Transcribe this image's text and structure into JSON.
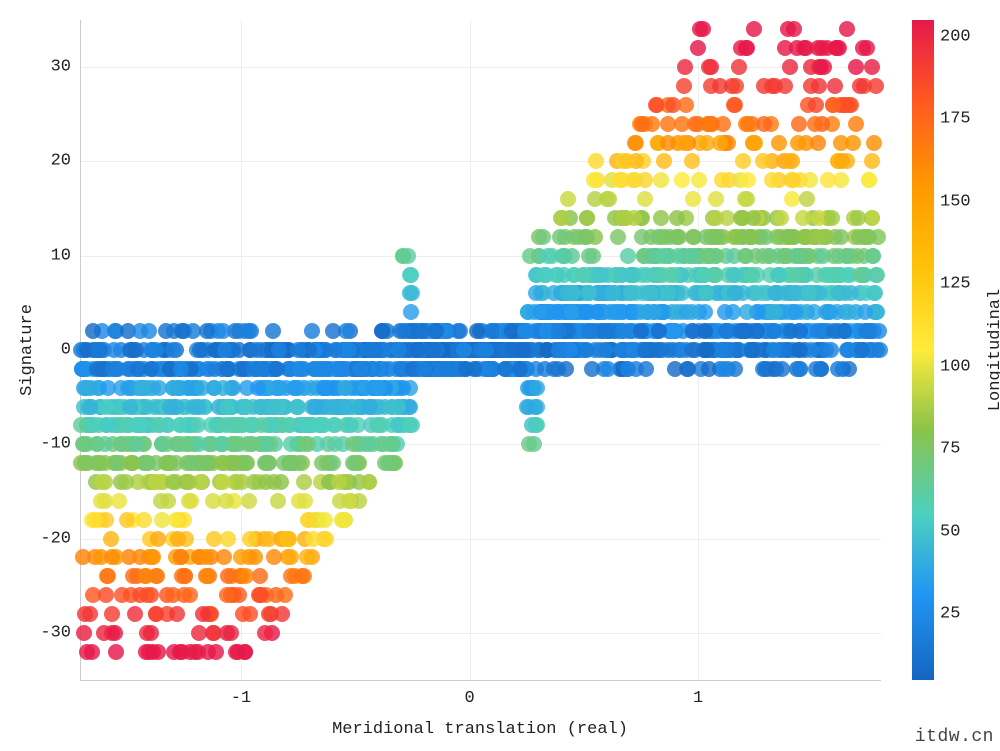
{
  "chart_data": {
    "type": "scatter",
    "title": "",
    "xlabel": "Meridional translation (real)",
    "ylabel": "Signature",
    "colorbar_label": "Longitudinal translation",
    "xlim": [
      -1.7,
      1.8
    ],
    "ylim": [
      -35,
      35
    ],
    "clim": [
      5,
      205
    ],
    "xticks": [
      -1,
      0,
      1
    ],
    "yticks": [
      -30,
      -20,
      -10,
      0,
      10,
      20,
      30
    ],
    "cticks": [
      25,
      50,
      75,
      100,
      125,
      150,
      175,
      200
    ],
    "generator": {
      "desc": "Dense bow-tie scatter: x in [-1.7,1.8], y in [-32,34]. For |x|<0.3 y≈0 (blue). Outward from center, |y| fans out linearly with |x|; color (Longitudinal translation) increases with |y| from blue→green→yellow→orange→red.",
      "n_approx": 2000
    },
    "series": [
      {
        "name": "points",
        "note": "procedurally regenerated from generator spec; values are representative of the visible distribution"
      }
    ]
  },
  "watermark": "itdw.cn",
  "labels": {
    "xlabel": "Meridional translation (real)",
    "ylabel": "Signature",
    "clabel": "Longitudinal translation",
    "watermark": "itdw.cn"
  }
}
